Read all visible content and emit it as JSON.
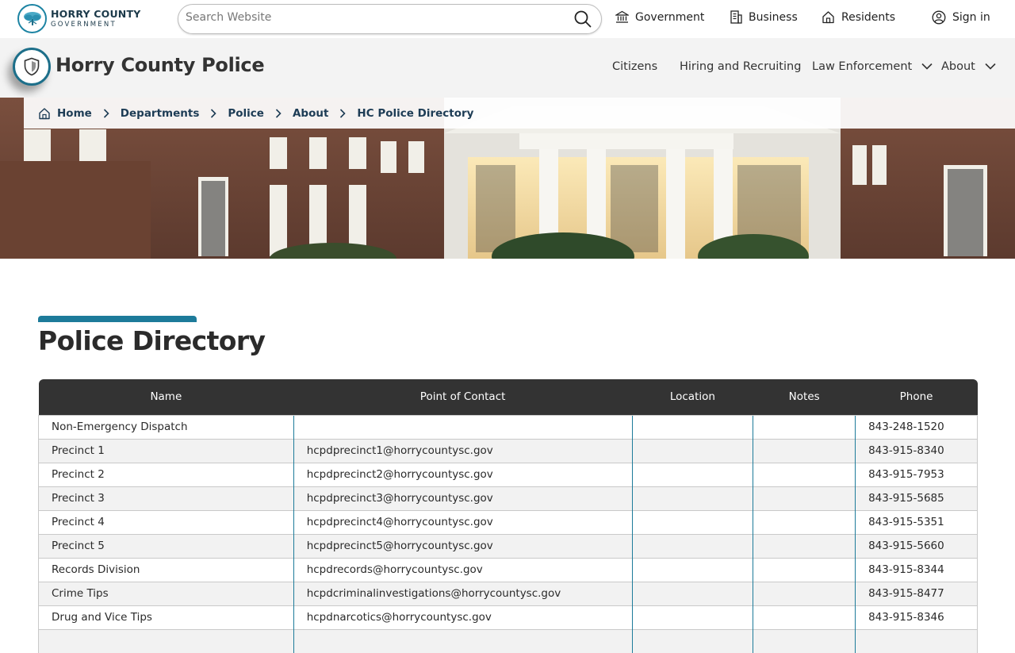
{
  "logo": {
    "line1": "HORRY COUNTY",
    "line2": "GOVERNMENT"
  },
  "search": {
    "placeholder": "Search Website"
  },
  "topnav": {
    "government": "Government",
    "business": "Business",
    "residents": "Residents",
    "signin": "Sign in"
  },
  "department": {
    "title": "Horry County Police"
  },
  "mainnav": {
    "citizens": "Citizens",
    "hiring": "Hiring and Recruiting",
    "law": "Law Enforcement",
    "about": "About"
  },
  "breadcrumb": [
    "Home",
    "Departments",
    "Police",
    "About",
    "HC Police Directory"
  ],
  "page": {
    "title": "Police Directory"
  },
  "table": {
    "headers": [
      "Name",
      "Point of Contact",
      "Location",
      "Notes",
      "Phone"
    ],
    "rows": [
      [
        "Non-Emergency Dispatch",
        "",
        "",
        "",
        "843-248-1520"
      ],
      [
        "Precinct 1",
        "hcpdprecinct1@horrycountysc.gov",
        "",
        "",
        "843-915-8340"
      ],
      [
        "Precinct 2",
        "hcpdprecinct2@horrycountysc.gov",
        "",
        "",
        "843-915-7953"
      ],
      [
        "Precinct 3",
        "hcpdprecinct3@horrycountysc.gov",
        "",
        "",
        "843-915-5685"
      ],
      [
        "Precinct 4",
        "hcpdprecinct4@horrycountysc.gov",
        "",
        "",
        "843-915-5351"
      ],
      [
        "Precinct 5",
        "hcpdprecinct5@horrycountysc.gov",
        "",
        "",
        "843-915-5660"
      ],
      [
        "Records Division",
        "hcpdrecords@horrycountysc.gov",
        "",
        "",
        "843-915-8344"
      ],
      [
        "Crime Tips",
        "hcpdcriminalinvestigations@horrycountysc.gov",
        "",
        "",
        "843-915-8477"
      ],
      [
        "Drug and Vice Tips",
        "hcpdnarcotics@horrycountysc.gov",
        "",
        "",
        "843-915-8346"
      ],
      [
        "",
        "",
        "",
        "",
        ""
      ]
    ]
  },
  "colors": {
    "accent": "#1d7b9a",
    "header_bg": "#333333",
    "brand_dark": "#1d3c55"
  }
}
